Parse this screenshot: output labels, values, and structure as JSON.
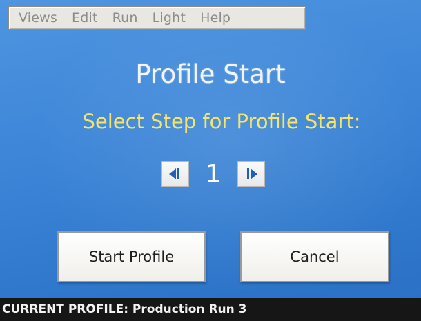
{
  "menu": {
    "items": [
      "Views",
      "Edit",
      "Run",
      "Light",
      "Help"
    ]
  },
  "screen": {
    "title": "Profile Start",
    "prompt": "Select Step for Profile Start:"
  },
  "stepper": {
    "value": "1",
    "decrement_icon": "step-back-icon",
    "increment_icon": "step-forward-icon"
  },
  "buttons": {
    "start": "Start Profile",
    "cancel": "Cancel"
  },
  "status": {
    "text": "CURRENT PROFILE: Production Run 3"
  },
  "colors": {
    "background": "#3d86d8",
    "prompt_text": "#f6e56a",
    "title_text": "#f4f4f4",
    "status_bar": "#161616",
    "menu_text_disabled": "#8c8c8c",
    "arrow_icon": "#1f5fb8"
  }
}
